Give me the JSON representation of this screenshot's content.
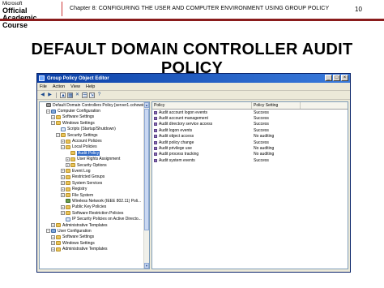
{
  "slide": {
    "logo_line1": "Microsoft",
    "logo_line2": "Official",
    "logo_line3": "Academic Course",
    "chapter": "Chapter 8: CONFIGURING THE USER AND COMPUTER ENVIRONMENT USING GROUP POLICY",
    "page_number": "10",
    "title": "DEFAULT DOMAIN CONTROLLER AUDIT POLICY"
  },
  "window": {
    "title": "Group Policy Object Editor",
    "minimize": "_",
    "maximize": "□",
    "close": "×"
  },
  "menu": {
    "file": "File",
    "action": "Action",
    "view": "View",
    "help": "Help"
  },
  "toolbar": {
    "icons": [
      "back-icon",
      "forward-icon",
      "up-icon",
      "show-hide-tree-icon",
      "delete-icon",
      "properties-icon",
      "export-icon",
      "help-icon"
    ]
  },
  "tree": {
    "items": [
      {
        "label": "Default Domain Controllers Policy [server1.cohowine...",
        "icon": "policy-icon",
        "expander": ""
      },
      {
        "label": "Computer Configuration",
        "icon": "computer-icon",
        "expander": "−"
      },
      {
        "label": "Software Settings",
        "icon": "folder-icon",
        "expander": "+"
      },
      {
        "label": "Windows Settings",
        "icon": "folder-icon",
        "expander": "−"
      },
      {
        "label": "Scripts (Startup/Shutdown)",
        "icon": "doc-icon",
        "expander": ""
      },
      {
        "label": "Security Settings",
        "icon": "folder-icon",
        "expander": "−"
      },
      {
        "label": "Account Policies",
        "icon": "folder-icon",
        "expander": "+"
      },
      {
        "label": "Local Policies",
        "icon": "folder-icon",
        "expander": "−"
      },
      {
        "label": "Audit Policy",
        "icon": "folder-icon",
        "expander": "",
        "selected": true
      },
      {
        "label": "User Rights Assignment",
        "icon": "folder-icon",
        "expander": "+"
      },
      {
        "label": "Security Options",
        "icon": "folder-icon",
        "expander": "+"
      },
      {
        "label": "Event Log",
        "icon": "folder-icon",
        "expander": "+"
      },
      {
        "label": "Restricted Groups",
        "icon": "folder-icon",
        "expander": "+"
      },
      {
        "label": "System Services",
        "icon": "folder-icon",
        "expander": "+"
      },
      {
        "label": "Registry",
        "icon": "folder-icon",
        "expander": "+"
      },
      {
        "label": "File System",
        "icon": "folder-icon",
        "expander": "+"
      },
      {
        "label": "Wireless Network (IEEE 802.11) Poli...",
        "icon": "wifi-icon",
        "expander": ""
      },
      {
        "label": "Public Key Policies",
        "icon": "folder-icon",
        "expander": "+"
      },
      {
        "label": "Software Restriction Policies",
        "icon": "folder-icon",
        "expander": "+"
      },
      {
        "label": "IP Security Policies on Active Directo...",
        "icon": "doc-icon",
        "expander": ""
      },
      {
        "label": "Administrative Templates",
        "icon": "folder-icon",
        "expander": "+"
      },
      {
        "label": "User Configuration",
        "icon": "computer-icon",
        "expander": "−"
      },
      {
        "label": "Software Settings",
        "icon": "folder-icon",
        "expander": "+"
      },
      {
        "label": "Windows Settings",
        "icon": "folder-icon",
        "expander": "+"
      },
      {
        "label": "Administrative Templates",
        "icon": "folder-icon",
        "expander": "+"
      }
    ]
  },
  "list": {
    "headers": {
      "policy": "Policy",
      "setting": "Policy Setting"
    },
    "rows": [
      {
        "policy": "Audit account logon events",
        "setting": "Success"
      },
      {
        "policy": "Audit account management",
        "setting": "Success"
      },
      {
        "policy": "Audit directory service access",
        "setting": "Success"
      },
      {
        "policy": "Audit logon events",
        "setting": "Success"
      },
      {
        "policy": "Audit object access",
        "setting": "No auditing"
      },
      {
        "policy": "Audit policy change",
        "setting": "Success"
      },
      {
        "policy": "Audit privilege use",
        "setting": "No auditing"
      },
      {
        "policy": "Audit process tracking",
        "setting": "No auditing"
      },
      {
        "policy": "Audit system events",
        "setting": "Success"
      }
    ]
  },
  "colors": {
    "title_bar": "#0a3fa6",
    "selection": "#316ac5",
    "header_rule": "#8a1c1c"
  }
}
